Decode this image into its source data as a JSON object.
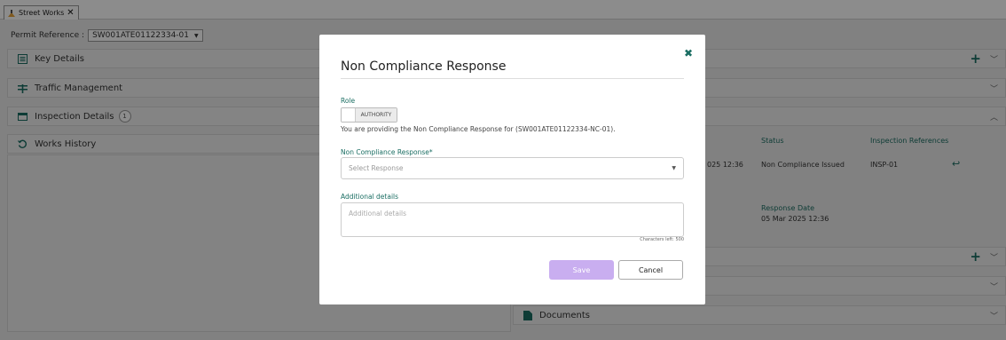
{
  "tab": {
    "label": "Street Works",
    "close": "✕"
  },
  "permit": {
    "label": "Permit Reference :",
    "value": "SW001ATE01122334-01"
  },
  "left_panels": [
    {
      "label": "Key Details",
      "icon": "list-icon"
    },
    {
      "label": "Traffic Management",
      "icon": "traffic-icon"
    },
    {
      "label": "Inspection Details",
      "icon": "table-icon",
      "count": "1"
    },
    {
      "label": "Works History",
      "icon": "history-icon"
    }
  ],
  "inspection_table": {
    "headers": {
      "status": "Status",
      "references": "Inspection References"
    },
    "row": {
      "date_fragment": "025 12:36",
      "status": "Non Compliance Issued",
      "reference": "INSP-01"
    },
    "response_date_label": "Response Date",
    "response_date_value": "05 Mar 2025 12:36"
  },
  "documents_panel": {
    "label": "Documents"
  },
  "modal": {
    "title": "Non Compliance Response",
    "role_label": "Role",
    "role_value": "AUTHORITY",
    "info_text": "You are providing the Non Compliance Response for (SW001ATE01122334-NC-01).",
    "response_label": "Non Compliance Response*",
    "response_placeholder": "Select Response",
    "details_label": "Additional details",
    "details_placeholder": "Additional details",
    "chars_left": "Characters left: 500",
    "save_label": "Save",
    "cancel_label": "Cancel"
  },
  "colors": {
    "accent": "#1b6e63",
    "save_disabled": "#c9aef0",
    "overlay": "rgba(0,0,0,0.45)"
  }
}
